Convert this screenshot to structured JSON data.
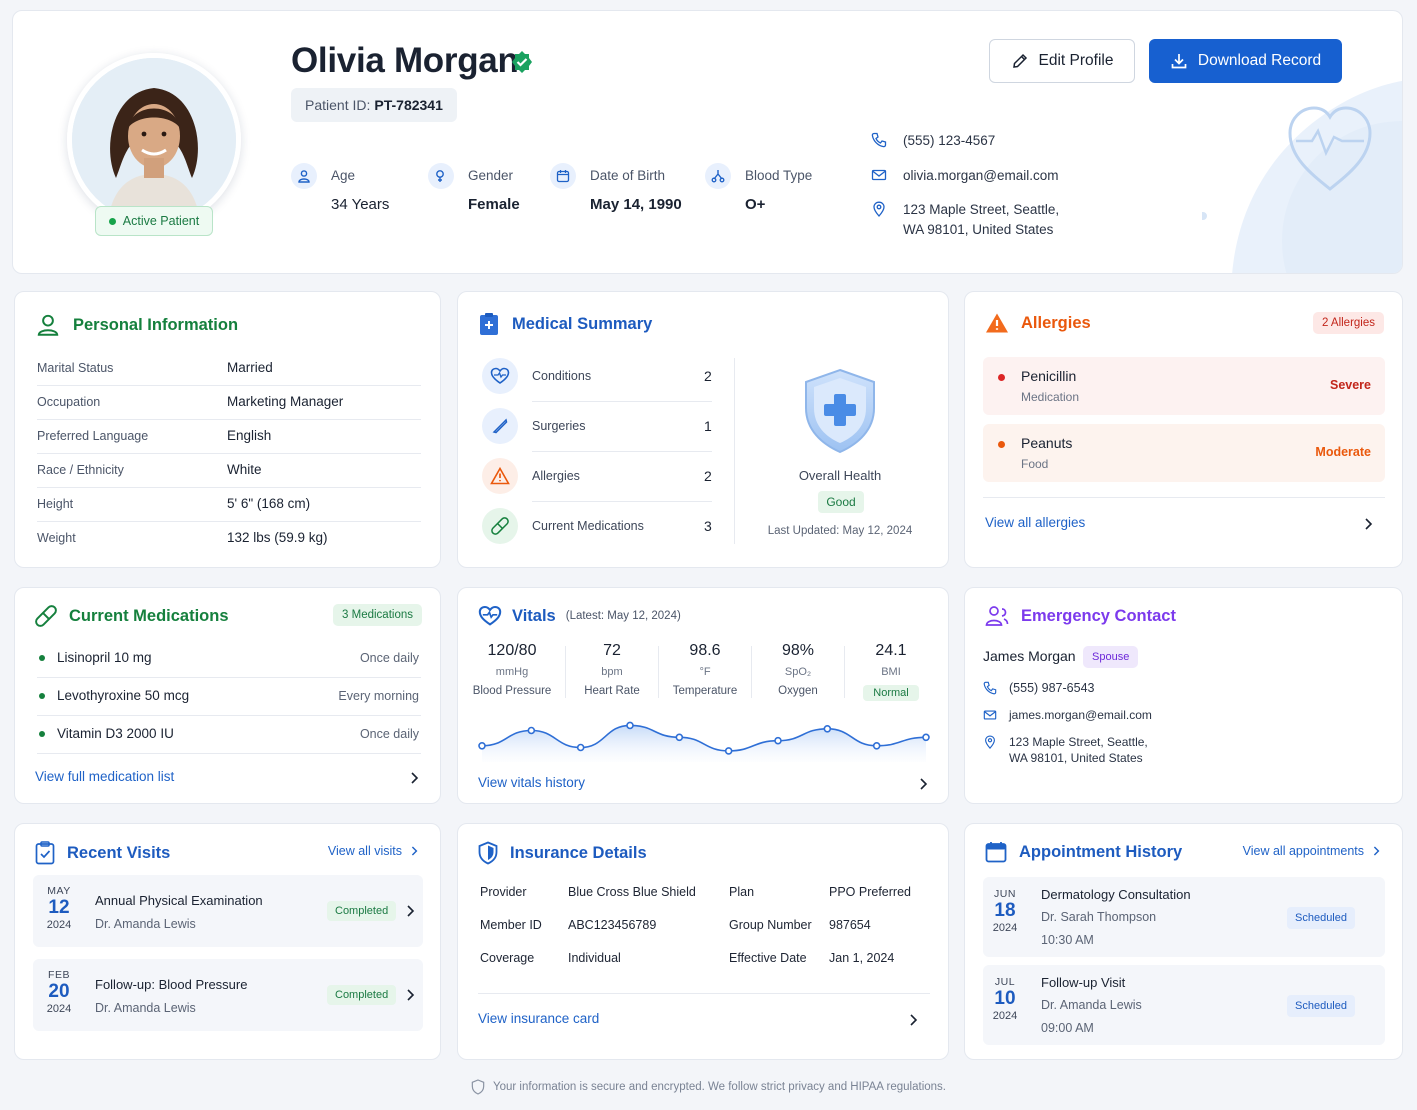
{
  "patient": {
    "name": "Olivia Morgan",
    "id_label": "Patient ID:",
    "id": "PT-782341",
    "status": "Active Patient",
    "stats": [
      {
        "label": "Age",
        "value": "34 Years",
        "icon": "person-icon"
      },
      {
        "label": "Gender",
        "value": "Female",
        "icon": "gender-icon"
      },
      {
        "label": "Date of Birth",
        "value": "May 14, 1990",
        "icon": "calendar-icon"
      },
      {
        "label": "Blood Type",
        "value": "O+",
        "icon": "blood-type-icon"
      }
    ],
    "phone": "(555) 123-4567",
    "email": "olivia.morgan@email.com",
    "address_line1": "123 Maple Street, Seattle,",
    "address_line2": "WA 98101, United States"
  },
  "actions": {
    "edit": "Edit Profile",
    "download": "Download Record"
  },
  "personal": {
    "title": "Personal Information",
    "rows": [
      {
        "k": "Marital Status",
        "v": "Married"
      },
      {
        "k": "Occupation",
        "v": "Marketing Manager"
      },
      {
        "k": "Preferred Language",
        "v": "English"
      },
      {
        "k": "Race / Ethnicity",
        "v": "White"
      },
      {
        "k": "Height",
        "v": "5' 6\" (168 cm)"
      },
      {
        "k": "Weight",
        "v": "132 lbs (59.9 kg)"
      }
    ]
  },
  "summary": {
    "title": "Medical Summary",
    "rows": [
      {
        "label": "Conditions",
        "count": "2"
      },
      {
        "label": "Surgeries",
        "count": "1"
      },
      {
        "label": "Allergies",
        "count": "2"
      },
      {
        "label": "Current Medications",
        "count": "3"
      }
    ],
    "overall_label": "Overall Health",
    "overall_status": "Good",
    "updated": "Last Updated: May 12, 2024"
  },
  "allergies": {
    "title": "Allergies",
    "badge": "2 Allergies",
    "items": [
      {
        "name": "Penicillin",
        "type": "Medication",
        "severity": "Severe",
        "color": "#dc2626"
      },
      {
        "name": "Peanuts",
        "type": "Food",
        "severity": "Moderate",
        "color": "#ea580c"
      }
    ],
    "link": "View all allergies"
  },
  "medications": {
    "title": "Current Medications",
    "badge": "3 Medications",
    "items": [
      {
        "name": "Lisinopril 10 mg",
        "freq": "Once daily"
      },
      {
        "name": "Levothyroxine 50 mcg",
        "freq": "Every morning"
      },
      {
        "name": "Vitamin D3 2000 IU",
        "freq": "Once daily"
      }
    ],
    "link": "View full medication list"
  },
  "vitals": {
    "title": "Vitals",
    "subtitle": "(Latest: May 12, 2024)",
    "items": [
      {
        "value": "120/80",
        "unit": "mmHg",
        "label": "Blood Pressure"
      },
      {
        "value": "72",
        "unit": "bpm",
        "label": "Heart Rate"
      },
      {
        "value": "98.6",
        "unit": "°F",
        "label": "Temperature"
      },
      {
        "value": "98%",
        "unit": "SpO₂",
        "label": "Oxygen"
      },
      {
        "value": "24.1",
        "unit": "BMI",
        "label": "Normal"
      }
    ],
    "trend": [
      0.3,
      0.75,
      0.25,
      0.9,
      0.55,
      0.15,
      0.45,
      0.8,
      0.3,
      0.55
    ],
    "link": "View vitals history"
  },
  "emergency": {
    "title": "Emergency Contact",
    "name": "James Morgan",
    "relation": "Spouse",
    "phone": "(555) 987-6543",
    "email": "james.morgan@email.com",
    "address_line1": "123 Maple Street, Seattle,",
    "address_line2": "WA 98101, United States"
  },
  "visits": {
    "title": "Recent Visits",
    "link": "View all visits",
    "items": [
      {
        "month": "MAY",
        "day": "12",
        "year": "2024",
        "title": "Annual Physical Examination",
        "doctor": "Dr. Amanda Lewis",
        "status": "Completed"
      },
      {
        "month": "FEB",
        "day": "20",
        "year": "2024",
        "title": "Follow-up: Blood Pressure",
        "doctor": "Dr. Amanda Lewis",
        "status": "Completed"
      }
    ]
  },
  "insurance": {
    "title": "Insurance Details",
    "provider_k": "Provider",
    "provider_v": "Blue Cross Blue Shield",
    "plan_k": "Plan",
    "plan_v": "PPO Preferred",
    "member_k": "Member ID",
    "member_v": "ABC123456789",
    "group_k": "Group Number",
    "group_v": "987654",
    "coverage_k": "Coverage",
    "coverage_v": "Individual",
    "effective_k": "Effective Date",
    "effective_v": "Jan 1, 2024",
    "link": "View insurance card"
  },
  "appointments": {
    "title": "Appointment History",
    "link": "View all appointments",
    "items": [
      {
        "month": "JUN",
        "day": "18",
        "year": "2024",
        "title": "Dermatology Consultation",
        "doctor": "Dr. Sarah Thompson",
        "time": "10:30 AM",
        "status": "Scheduled"
      },
      {
        "month": "JUL",
        "day": "10",
        "year": "2024",
        "title": "Follow-up Visit",
        "doctor": "Dr. Amanda Lewis",
        "time": "09:00 AM",
        "status": "Scheduled"
      }
    ]
  },
  "footer": "Your information is secure and encrypted. We follow strict privacy and HIPAA regulations.",
  "colors": {
    "primary": "#1760d0",
    "green": "#15803d",
    "orange": "#ea580c",
    "purple": "#7c3aed"
  }
}
